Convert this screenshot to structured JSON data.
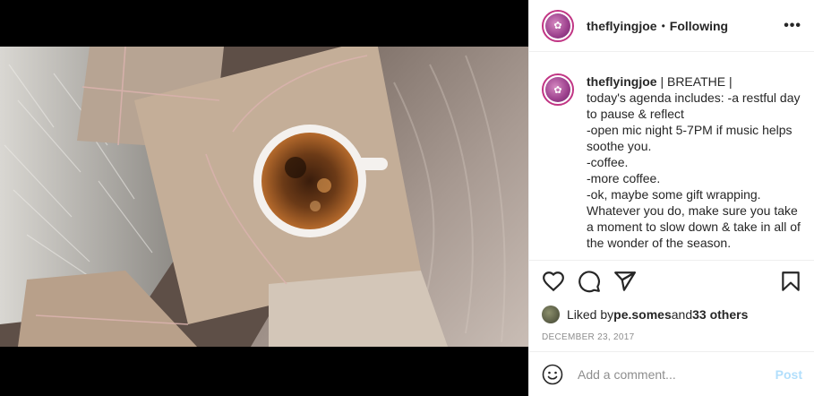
{
  "post": {
    "username": "theflyingjoe",
    "separator": "•",
    "follow_status": "Following",
    "more_label": "•••",
    "avatar_glyph": "✿"
  },
  "caption": {
    "username": "theflyingjoe",
    "lines": [
      " | BREATHE |",
      "today's agenda includes: -a restful day to pause & reflect",
      "-open mic night 5-7PM if music helps soothe you.",
      "-coffee.",
      "-more coffee.",
      "-ok, maybe some gift wrapping.",
      "Whatever you do, make sure you take a moment to slow down & take in all of the wonder of the season."
    ]
  },
  "actions": {
    "like_icon": "heart-icon",
    "comment_icon": "comment-icon",
    "share_icon": "share-icon",
    "save_icon": "bookmark-icon"
  },
  "likes": {
    "prefix": "Liked by ",
    "user": "pe.somes",
    "middle": " and ",
    "others": "33 others"
  },
  "date": "DECEMBER 23, 2017",
  "comment_box": {
    "placeholder": "Add a comment...",
    "post_label": "Post",
    "emoji_icon": "smile-icon"
  },
  "colors": {
    "avatar_ring": "#c13584",
    "post_button": "#b2dffc",
    "muted_text": "#8e8e8e"
  }
}
